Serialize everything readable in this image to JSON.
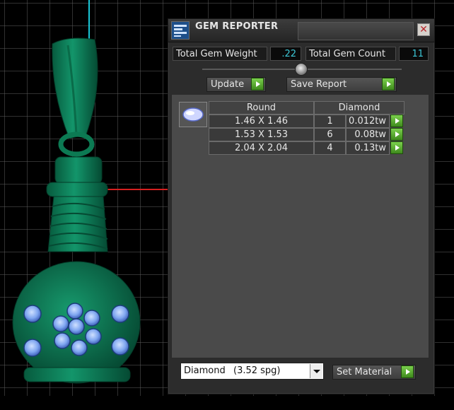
{
  "window": {
    "title": "GEM REPORTER",
    "close_icon": "close-icon"
  },
  "summary": {
    "total_weight_label": "Total Gem Weight",
    "total_weight_value": ".22",
    "total_count_label": "Total Gem Count",
    "total_count_value": "11"
  },
  "slider": {
    "level": 0.5
  },
  "buttons": {
    "update": "Update",
    "save_report": "Save Report",
    "set_material": "Set Material"
  },
  "gem_table": {
    "shape_header": "Round",
    "material_header": "Diamond",
    "rows": [
      {
        "size": "1.46 X 1.46",
        "count": "1",
        "weight": "0.012tw"
      },
      {
        "size": "1.53 X 1.53",
        "count": "6",
        "weight": "0.08tw"
      },
      {
        "size": "2.04 X 2.04",
        "count": "4",
        "weight": "0.13tw"
      }
    ]
  },
  "material_select": {
    "selected": "Diamond",
    "density": "(3.52 spg)"
  },
  "colors": {
    "panel_bg": "#2c2c2c",
    "accent_cyan": "#3cc7d6",
    "go_green": "#5bb32e",
    "model_green": "#0f7a55",
    "gem_blue": "#8ab4ff"
  }
}
